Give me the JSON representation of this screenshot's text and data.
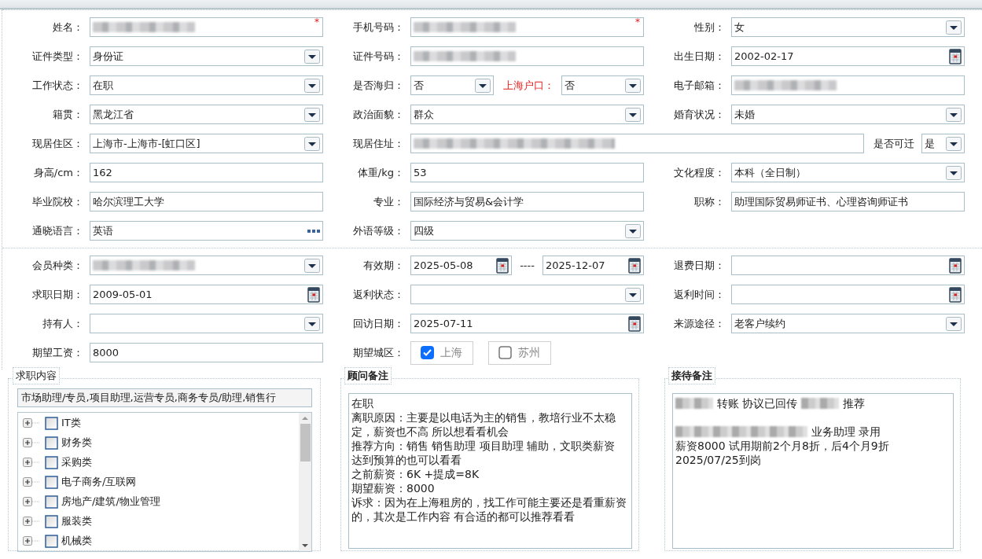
{
  "sections": [
    {
      "rows": [
        {
          "groups": [
            {
              "label": "姓名：",
              "items": [
                {
                  "kind": "text",
                  "blurred": true,
                  "required_mark": "*"
                }
              ]
            },
            {
              "label": "手机号码：",
              "items": [
                {
                  "kind": "text",
                  "blurred": true,
                  "required_mark": "*"
                }
              ]
            },
            {
              "label": "性别：",
              "items": [
                {
                  "kind": "select",
                  "value": "女"
                }
              ]
            }
          ]
        },
        {
          "groups": [
            {
              "label": "证件类型：",
              "items": [
                {
                  "kind": "select",
                  "value": "身份证"
                }
              ]
            },
            {
              "label": "证件号码：",
              "items": [
                {
                  "kind": "text",
                  "blurred": true
                }
              ]
            },
            {
              "label": "出生日期：",
              "items": [
                {
                  "kind": "date",
                  "value": "2002-02-17"
                }
              ]
            }
          ]
        },
        {
          "groups": [
            {
              "label": "工作状态：",
              "items": [
                {
                  "kind": "select",
                  "value": "在职"
                }
              ]
            },
            {
              "label": "是否海归：",
              "items": [
                {
                  "kind": "select",
                  "value": "否"
                },
                {
                  "kind": "label",
                  "text": "上海户口：",
                  "red": true
                },
                {
                  "kind": "select",
                  "value": "否"
                }
              ]
            },
            {
              "label": "电子邮箱：",
              "items": [
                {
                  "kind": "text",
                  "blurred": true
                }
              ]
            }
          ]
        },
        {
          "groups": [
            {
              "label": "籍贯：",
              "items": [
                {
                  "kind": "select",
                  "value": "黑龙江省"
                }
              ]
            },
            {
              "label": "政治面貌：",
              "items": [
                {
                  "kind": "select",
                  "value": "群众"
                }
              ]
            },
            {
              "label": "婚育状况：",
              "items": [
                {
                  "kind": "select",
                  "value": "未婚"
                }
              ]
            }
          ]
        },
        {
          "groups": [
            {
              "label": "现居住区：",
              "items": [
                {
                  "kind": "select",
                  "value": "上海市-上海市-[虹口区]"
                }
              ]
            },
            {
              "label": "现居住址：",
              "wide": true,
              "items": [
                {
                  "kind": "text",
                  "blurred": true
                },
                {
                  "kind": "label",
                  "text": "是否可迁",
                  "red": false
                },
                {
                  "kind": "select",
                  "value": "是"
                }
              ]
            }
          ]
        },
        {
          "groups": [
            {
              "label": "身高/cm：",
              "items": [
                {
                  "kind": "text",
                  "value": "162"
                }
              ]
            },
            {
              "label": "体重/kg：",
              "items": [
                {
                  "kind": "text",
                  "value": "53"
                }
              ]
            },
            {
              "label": "文化程度：",
              "items": [
                {
                  "kind": "select",
                  "value": "本科（全日制）"
                }
              ]
            }
          ]
        },
        {
          "groups": [
            {
              "label": "毕业院校：",
              "items": [
                {
                  "kind": "text",
                  "value": "哈尔滨理工大学"
                }
              ]
            },
            {
              "label": "专业：",
              "items": [
                {
                  "kind": "text",
                  "value": "国际经济与贸易&会计学"
                }
              ]
            },
            {
              "label": "职称：",
              "items": [
                {
                  "kind": "text",
                  "value": "助理国际贸易师证书、心理咨询师证书"
                }
              ]
            }
          ]
        },
        {
          "groups": [
            {
              "label": "通晓语言：",
              "items": [
                {
                  "kind": "picker",
                  "value": "英语"
                }
              ]
            },
            {
              "label": "外语等级：",
              "items": [
                {
                  "kind": "select",
                  "value": "四级"
                }
              ]
            }
          ]
        }
      ]
    },
    {
      "rows": [
        {
          "groups": [
            {
              "label": "会员种类：",
              "items": [
                {
                  "kind": "select",
                  "blurred": true
                }
              ]
            },
            {
              "label": "有效期：",
              "items": [
                {
                  "kind": "date",
                  "value": "2025-05-08"
                },
                {
                  "kind": "separator",
                  "text": "----"
                },
                {
                  "kind": "date",
                  "value": "2025-12-07"
                }
              ]
            },
            {
              "label": "退费日期：",
              "items": [
                {
                  "kind": "date"
                }
              ]
            }
          ]
        },
        {
          "groups": [
            {
              "label": "求职日期：",
              "items": [
                {
                  "kind": "date",
                  "value": "2009-05-01"
                }
              ]
            },
            {
              "label": "返利状态：",
              "items": [
                {
                  "kind": "select"
                }
              ]
            },
            {
              "label": "返利时间：",
              "items": [
                {
                  "kind": "date"
                }
              ]
            }
          ]
        },
        {
          "groups": [
            {
              "label": "持有人：",
              "items": [
                {
                  "kind": "select"
                }
              ]
            },
            {
              "label": "回访日期：",
              "items": [
                {
                  "kind": "date",
                  "value": "2025-07-11"
                }
              ]
            },
            {
              "label": "来源途径：",
              "items": [
                {
                  "kind": "select",
                  "value": "老客户续约"
                }
              ]
            }
          ]
        },
        {
          "groups": [
            {
              "label": "期望工资：",
              "items": [
                {
                  "kind": "text",
                  "value": "8000"
                }
              ]
            },
            {
              "label": "期望城区：",
              "items": [
                {
                  "kind": "checkbox",
                  "label": "上海",
                  "checked": true
                },
                {
                  "kind": "checkbox",
                  "label": "苏州",
                  "checked": false
                }
              ]
            }
          ]
        }
      ]
    }
  ],
  "panels": [
    {
      "kind": "tree",
      "legend": "求职内容",
      "bold": false,
      "selected_text": "市场助理/专员,项目助理,运营专员,商务专员/助理,销售行",
      "tree": [
        {
          "label": "IT类",
          "checked": false,
          "expanded": false
        },
        {
          "label": "财务类",
          "checked": false,
          "expanded": false
        },
        {
          "label": "采购类",
          "checked": false,
          "expanded": false
        },
        {
          "label": "电子商务/互联网",
          "checked": false,
          "expanded": false
        },
        {
          "label": "房地产/建筑/物业管理",
          "checked": false,
          "expanded": false
        },
        {
          "label": "服装类",
          "checked": false,
          "expanded": false
        },
        {
          "label": "机械类",
          "checked": false,
          "expanded": false
        }
      ]
    },
    {
      "kind": "notes",
      "legend": "顾问备注",
      "bold": true,
      "lines": [
        {
          "segments": [
            {
              "kind": "text",
              "text": "在职"
            }
          ]
        },
        {
          "segments": [
            {
              "kind": "text",
              "text": "离职原因：主要是以电话为主的销售，教培行业不太稳"
            }
          ]
        },
        {
          "segments": [
            {
              "kind": "text",
              "text": "定，薪资也不高 所以想看看机会"
            }
          ]
        },
        {
          "segments": [
            {
              "kind": "text",
              "text": "推荐方向：销售 销售助理  项目助理 辅助，文职类薪资"
            }
          ]
        },
        {
          "segments": [
            {
              "kind": "text",
              "text": "达到预算的也可以看看"
            }
          ]
        },
        {
          "segments": [
            {
              "kind": "text",
              "text": "之前薪资：6K +提成=8K"
            }
          ]
        },
        {
          "segments": [
            {
              "kind": "text",
              "text": "期望薪资：8000"
            }
          ]
        },
        {
          "segments": [
            {
              "kind": "text",
              "text": "诉求：因为在上海租房的，找工作可能主要还是看重薪资"
            }
          ]
        },
        {
          "segments": [
            {
              "kind": "text",
              "text": "的，其次是工作内容 有合适的都可以推荐看看"
            }
          ]
        }
      ]
    },
    {
      "kind": "notes",
      "legend": "接待备注",
      "bold": true,
      "lines": [
        {
          "segments": [
            {
              "kind": "blur",
              "wide": false
            },
            {
              "kind": "text",
              "text": "转账 协议已回传"
            },
            {
              "kind": "blur",
              "wide": false
            },
            {
              "kind": "text",
              "text": "推荐"
            }
          ]
        },
        {
          "gap_before": true,
          "segments": [
            {
              "kind": "blur",
              "wide": true
            },
            {
              "kind": "text",
              "text": "业务助理 录用"
            }
          ]
        },
        {
          "segments": [
            {
              "kind": "text",
              "text": "薪资8000 试用期前2个月8折，后4个月9折"
            }
          ]
        },
        {
          "segments": [
            {
              "kind": "text",
              "text": "2025/07/25到岗"
            }
          ]
        }
      ]
    }
  ]
}
